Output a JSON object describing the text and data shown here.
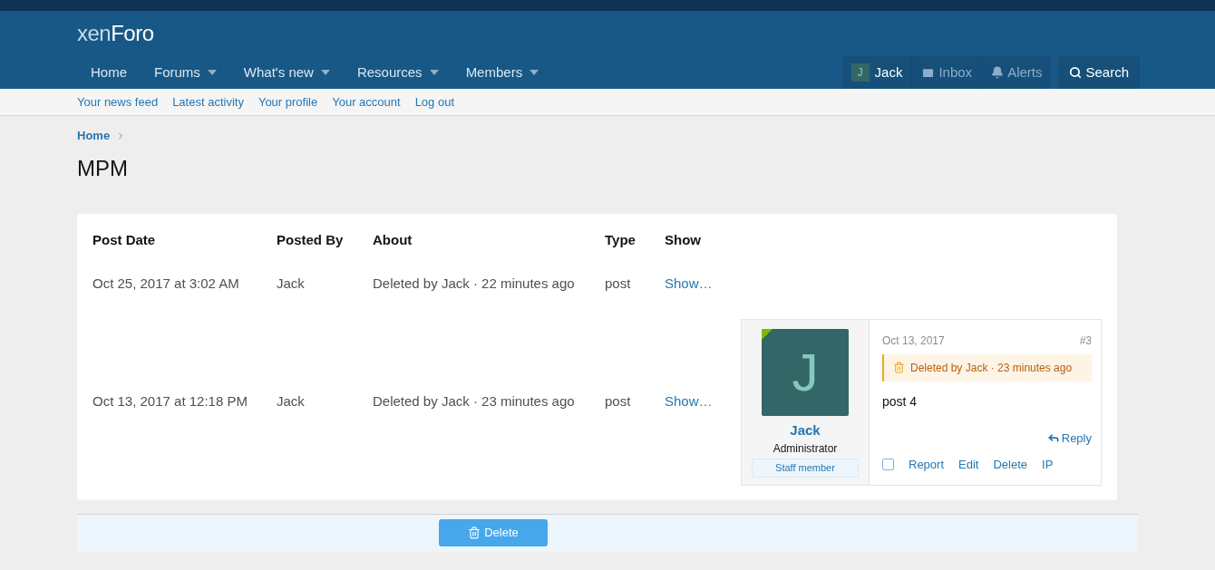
{
  "logo": {
    "light": "xen",
    "strong": "Foro"
  },
  "nav": [
    {
      "label": "Home",
      "dropdown": false
    },
    {
      "label": "Forums",
      "dropdown": true
    },
    {
      "label": "What's new",
      "dropdown": true
    },
    {
      "label": "Resources",
      "dropdown": true
    },
    {
      "label": "Members",
      "dropdown": true
    }
  ],
  "account": {
    "avatar_letter": "J",
    "name": "Jack",
    "inbox": "Inbox",
    "alerts": "Alerts",
    "search": "Search"
  },
  "subnav": [
    "Your news feed",
    "Latest activity",
    "Your profile",
    "Your account",
    "Log out"
  ],
  "breadcrumb": [
    "Home"
  ],
  "title": "MPM",
  "table": {
    "columns": [
      "Post Date",
      "Posted By",
      "About",
      "Type",
      "Show"
    ],
    "rows": [
      {
        "date": "Oct 25, 2017 at 3:02 AM",
        "by": "Jack",
        "about": "Deleted by Jack · 22 minutes ago",
        "type": "post",
        "show": "Show…"
      },
      {
        "date": "Oct 13, 2017 at 12:18 PM",
        "by": "Jack",
        "about": "Deleted by Jack · 23 minutes ago",
        "type": "post",
        "show": "Show…",
        "post": {
          "avatar_letter": "J",
          "online": true,
          "user": "Jack",
          "role": "Administrator",
          "badge": "Staff member",
          "date": "Oct 13, 2017",
          "number": "#3",
          "deleted_notice": "Deleted by Jack · 23 minutes ago",
          "body": "post 4",
          "reply": "Reply",
          "selected": false,
          "actions": [
            "Report",
            "Edit",
            "Delete",
            "IP"
          ]
        }
      }
    ]
  },
  "footer_button": "Delete"
}
